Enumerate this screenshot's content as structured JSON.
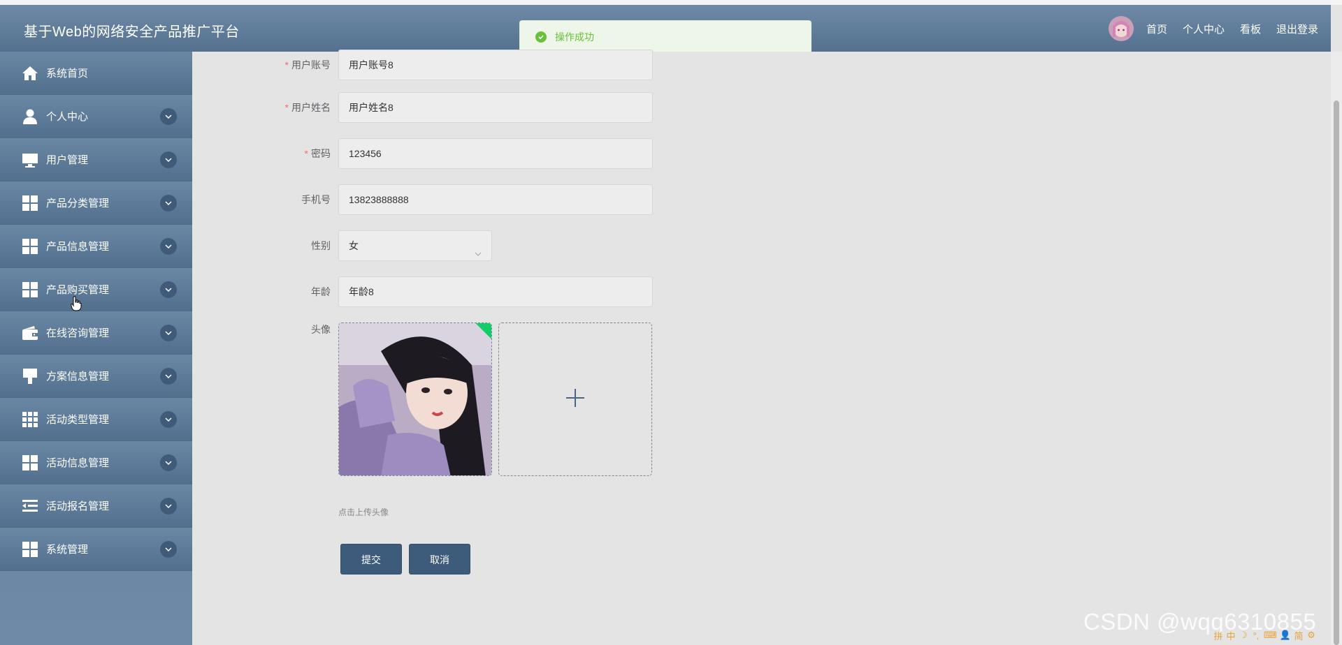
{
  "app": {
    "title": "基于Web的网络安全产品推广平台"
  },
  "header_nav": {
    "items": [
      "首页",
      "个人中心",
      "看板",
      "退出登录"
    ]
  },
  "toast": {
    "message": "操作成功",
    "type": "success"
  },
  "sidebar": {
    "items": [
      {
        "label": "系统首页",
        "icon": "home-icon"
      },
      {
        "label": "个人中心",
        "icon": "user-icon"
      },
      {
        "label": "用户管理",
        "icon": "monitor-icon"
      },
      {
        "label": "产品分类管理",
        "icon": "grid-icon"
      },
      {
        "label": "产品信息管理",
        "icon": "grid-icon"
      },
      {
        "label": "产品购买管理",
        "icon": "grid-icon"
      },
      {
        "label": "在线咨询管理",
        "icon": "wallet-icon"
      },
      {
        "label": "方案信息管理",
        "icon": "brush-icon"
      },
      {
        "label": "活动类型管理",
        "icon": "grid-nine-icon"
      },
      {
        "label": "活动信息管理",
        "icon": "grid-icon"
      },
      {
        "label": "活动报名管理",
        "icon": "list-indent-icon"
      },
      {
        "label": "系统管理",
        "icon": "grid-icon"
      }
    ]
  },
  "form": {
    "fields": [
      {
        "label": "用户账号",
        "required": "*",
        "value": "用户账号8"
      },
      {
        "label": "用户姓名",
        "required": "*",
        "value": "用户姓名8"
      },
      {
        "label": "密码",
        "required": "*",
        "value": "123456"
      },
      {
        "label": "手机号",
        "required": "",
        "value": "13823888888"
      },
      {
        "label": "性别",
        "required": "",
        "value": "女"
      },
      {
        "label": "年龄",
        "required": "",
        "value": "年龄8"
      }
    ],
    "avatar_label": "头像",
    "upload_hint": "点击上传头像",
    "submit_label": "提交",
    "cancel_label": "取消"
  },
  "watermark": "CSDN @wqq6310855",
  "ime": [
    "拼",
    "中",
    "☽",
    "°,",
    "⌨",
    "👤",
    "简",
    "⚙"
  ],
  "colors": {
    "header": "#5f7c9a",
    "sidebar": "#5d7a98",
    "button": "#3d5b7a",
    "success": "#67c23a",
    "required": "#f56c6c"
  }
}
